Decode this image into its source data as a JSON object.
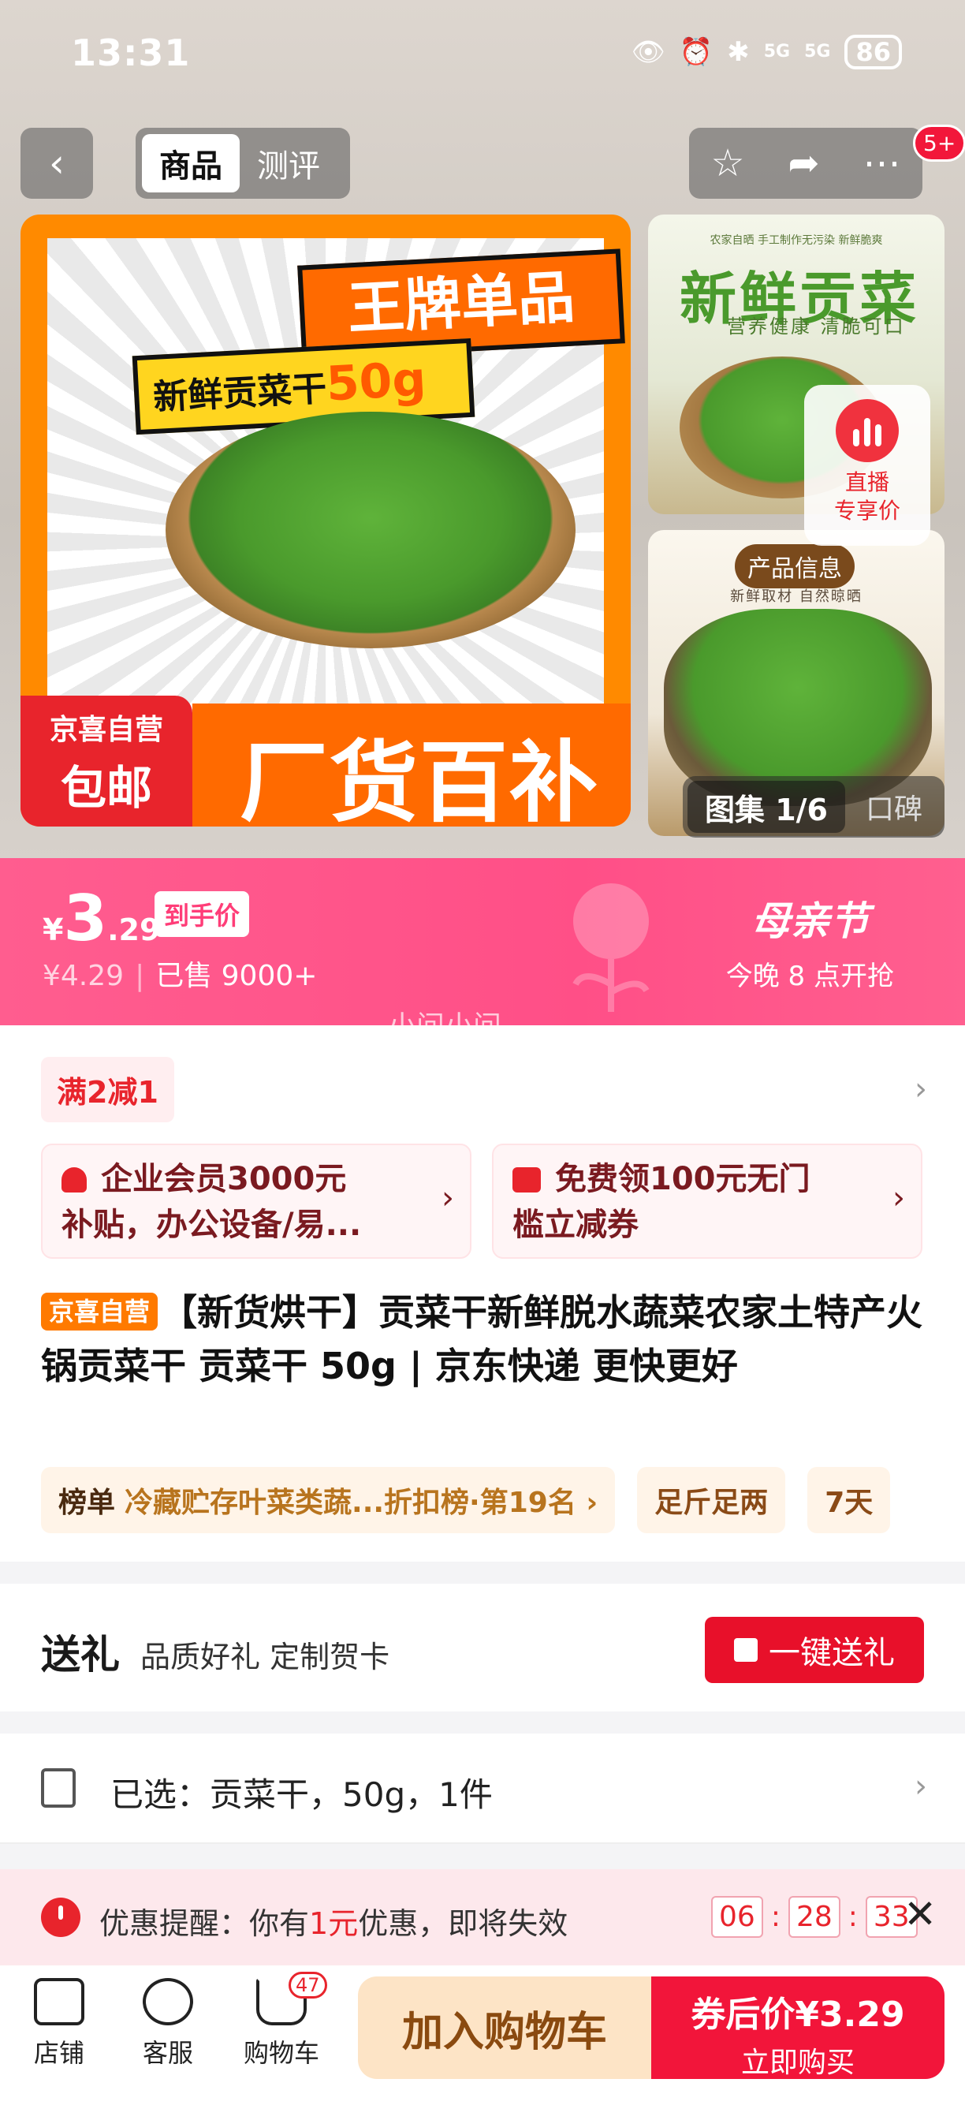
{
  "status_bar": {
    "time": "13:31",
    "network1": "5G",
    "network2": "5G",
    "battery": "86"
  },
  "nav": {
    "tabs": [
      "商品",
      "测评"
    ],
    "cart_count": "5+"
  },
  "gallery": {
    "main_image": {
      "banner_top": "王牌单品",
      "banner_product": "新鲜贡菜干",
      "banner_weight": "50g",
      "sticker_line1": "京喜自营",
      "sticker_line2": "包邮",
      "bottom_text": "厂货百补"
    },
    "thumb1": {
      "small_text": "农家自晒 手工制作无污染 新鲜脆爽",
      "title": "新鲜贡菜",
      "subtitle": "营养健康 清脆可口"
    },
    "thumb2": {
      "badge": "产品信息",
      "subtitle": "新鲜取材 自然晾晒"
    },
    "live": {
      "line1": "直播",
      "line2": "专享价"
    },
    "tag_gallery": "图集 1/6",
    "tag_review": "口碑"
  },
  "price": {
    "currency": "¥",
    "integer": "3",
    "decimal": ".29",
    "label": "到手价",
    "original": "¥4.29",
    "sold": "已售 9000+",
    "festival_title": "母亲节",
    "festival_sub": "今晚 8 点开抢"
  },
  "watermark": "小问小问",
  "promo": {
    "coupon_tag": "满2减1",
    "card1_line1": "企业会员3000元",
    "card1_line2": "补贴，办公设备/易...",
    "card2_line1": "免费领100元无门",
    "card2_line2": "槛立减券"
  },
  "product": {
    "badge": "京喜自营",
    "title": "【新货烘干】贡菜干新鲜脱水蔬菜农家土特产火锅贡菜干 贡菜干 50g | 京东快递 更快更好"
  },
  "ranks": [
    {
      "title": "榜单",
      "value": "冷藏贮存叶菜类蔬...折扣榜·第19名 ›"
    },
    {
      "title": "",
      "value": "足斤足两"
    },
    {
      "title": "",
      "value": "7天"
    }
  ],
  "gift": {
    "title": "送礼",
    "subtitle": "品质好礼 定制贺卡",
    "button": "一键送礼"
  },
  "selected": {
    "text": "已选：贡菜干，50g，1件"
  },
  "reminder": {
    "prefix": "优惠提醒：你有",
    "amount": "1元",
    "suffix": "优惠，即将失效",
    "hours": "06",
    "minutes": "28",
    "seconds": "33"
  },
  "bottom_bar": {
    "store": "店铺",
    "service": "客服",
    "cart": "购物车",
    "cart_badge": "47",
    "add_cart": "加入购物车",
    "buy_label": "券后价¥3.29",
    "buy_action": "立即购买"
  },
  "colors": {
    "primary_red": "#f2153a",
    "price_pink": "#ff4f87",
    "self_orange": "#ff7a00"
  }
}
